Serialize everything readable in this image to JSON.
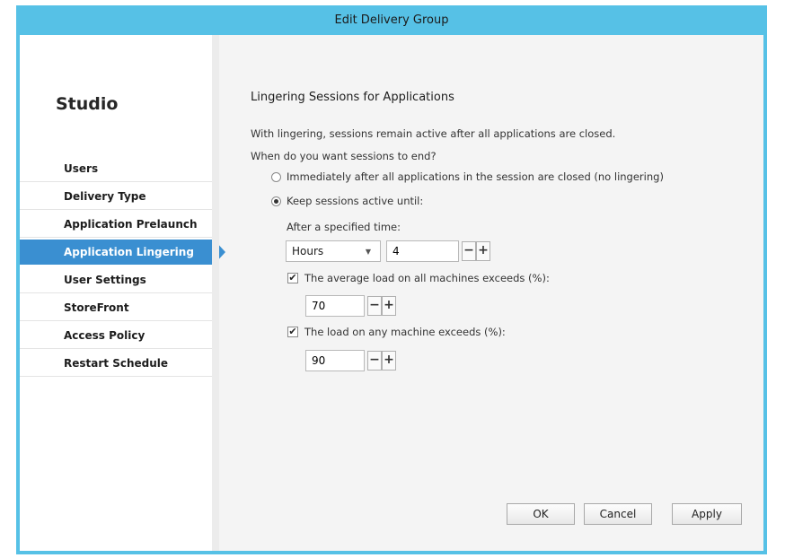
{
  "window": {
    "title": "Edit Delivery Group"
  },
  "sidebar": {
    "title": "Studio",
    "items": [
      {
        "label": "Users"
      },
      {
        "label": "Delivery Type"
      },
      {
        "label": "Application Prelaunch"
      },
      {
        "label": "Application Lingering",
        "selected": true
      },
      {
        "label": "User Settings"
      },
      {
        "label": "StoreFront"
      },
      {
        "label": "Access Policy"
      },
      {
        "label": "Restart Schedule"
      }
    ]
  },
  "main": {
    "heading": "Lingering Sessions for Applications",
    "description": "With lingering, sessions remain active after all applications are closed.",
    "question": "When do you want sessions to end?",
    "option_immediately": "Immediately after all applications in the session are closed (no lingering)",
    "option_keep_active": "Keep sessions active until:",
    "selected_option": "keep_active",
    "time_label": "After a specified time:",
    "time_unit": "Hours",
    "time_value": "4",
    "average_load_label": "The average load on all machines exceeds (%):",
    "average_load_checked": true,
    "average_load_value": "70",
    "any_load_label": "The load on any machine exceeds (%):",
    "any_load_checked": true,
    "any_load_value": "90",
    "minus": "−",
    "plus": "+",
    "check_mark": "✔"
  },
  "footer": {
    "ok_label": "OK",
    "cancel_label": "Cancel",
    "apply_label": "Apply"
  },
  "colors": {
    "titlebar": "#56c1e6",
    "selected_nav": "#3a8fd1"
  }
}
